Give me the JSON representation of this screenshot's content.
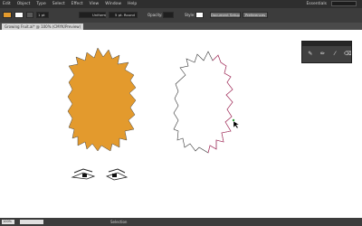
{
  "menubar": {
    "items": [
      "Edit",
      "Object",
      "Type",
      "Select",
      "Effect",
      "View",
      "Window",
      "Help"
    ],
    "workspace": "Essentials"
  },
  "controlbar": {
    "stroke_weight": "1 pt",
    "stroke_profile": "Uniform",
    "brush": "5 pt. Round",
    "opacity_label": "Opacity:",
    "style_label": "Style:",
    "document_setup": "Document Setup",
    "preferences": "Preferences"
  },
  "document": {
    "tab_title": "Growing Fruit.ai* @ 100% (CMYK/Preview)"
  },
  "status": {
    "zoom": "100%",
    "tool": "Selection"
  },
  "panel": {
    "tools": [
      "brush-tool-icon",
      "pencil-tool-icon",
      "smooth-tool-icon",
      "path-eraser-icon"
    ]
  },
  "colors": {
    "fill": "#e39a2d",
    "stroke": "#333333",
    "selection": "#c0336a"
  }
}
